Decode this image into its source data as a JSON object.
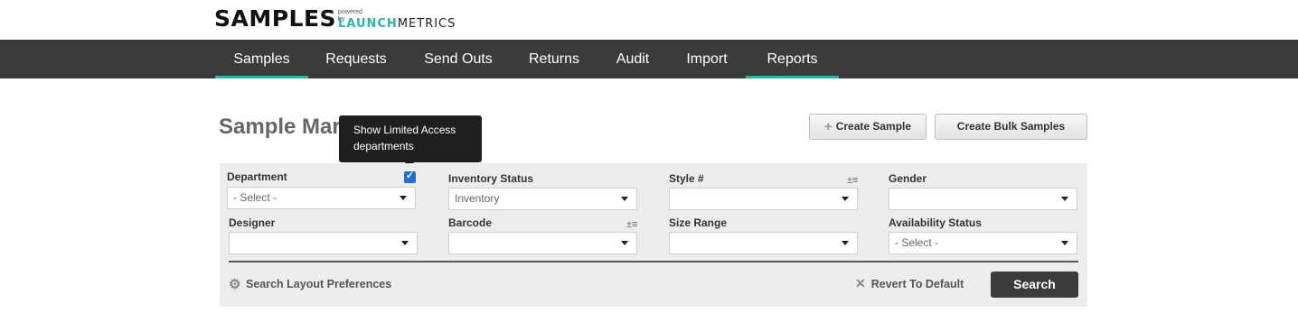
{
  "brand": {
    "name": "SAMPLES",
    "powered_by": "powered by",
    "partner_a": "LAUNCH",
    "partner_b": "METRICS"
  },
  "nav": {
    "items": [
      {
        "label": "Samples",
        "active": true
      },
      {
        "label": "Requests"
      },
      {
        "label": "Send Outs"
      },
      {
        "label": "Returns"
      },
      {
        "label": "Audit"
      },
      {
        "label": "Import"
      },
      {
        "label": "Reports",
        "active": true
      }
    ]
  },
  "page": {
    "title": "Sample Mar",
    "tooltip": "Show Limited Access departments"
  },
  "actions": {
    "create_sample": "Create Sample",
    "create_bulk": "Create Bulk Samples"
  },
  "filters": {
    "department": {
      "label": "Department",
      "value": "- Select -",
      "limited_access_checked": true
    },
    "inventory_status": {
      "label": "Inventory Status",
      "value": "Inventory"
    },
    "style": {
      "label": "Style #",
      "value": ""
    },
    "gender": {
      "label": "Gender",
      "value": ""
    },
    "designer": {
      "label": "Designer",
      "value": ""
    },
    "barcode": {
      "label": "Barcode",
      "value": ""
    },
    "size_range": {
      "label": "Size Range",
      "value": ""
    },
    "availability_status": {
      "label": "Availability Status",
      "value": "- Select -"
    }
  },
  "footer": {
    "prefs": "Search Layout Preferences",
    "revert": "Revert To Default",
    "search": "Search"
  },
  "colors": {
    "accent": "#2bb6a3",
    "navbar": "#3b3b3b",
    "checkbox": "#1f6fd6"
  }
}
